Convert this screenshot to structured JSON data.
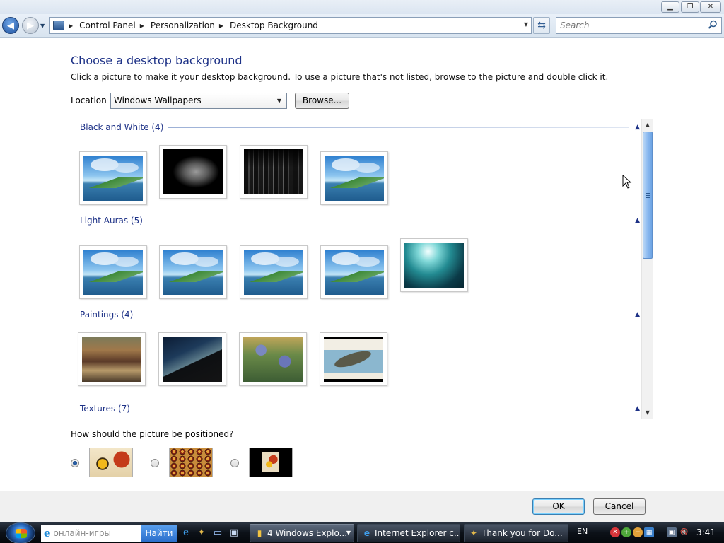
{
  "window": {
    "minimize_icon": "minimize-icon",
    "maximize_icon": "maximize-icon",
    "close_icon": "close-icon"
  },
  "address_bar": {
    "breadcrumbs": [
      "Control Panel",
      "Personalization",
      "Desktop Background"
    ],
    "search_placeholder": "Search"
  },
  "page": {
    "title": "Choose a desktop background",
    "subtitle": "Click a picture to make it your desktop background. To use a picture that's not listed, browse to the picture and double click it.",
    "location_label": "Location",
    "location_value": "Windows Wallpapers",
    "browse_label": "Browse..."
  },
  "gallery": {
    "groups": [
      {
        "title": "Black and White (4)",
        "thumbs": [
          "lake",
          "leaf",
          "city",
          "lake"
        ]
      },
      {
        "title": "Light Auras (5)",
        "thumbs": [
          "lake",
          "lake",
          "lake",
          "lake",
          "aurora"
        ]
      },
      {
        "title": "Paintings (4)",
        "thumbs": [
          "seurat",
          "bridge",
          "iris",
          "koi"
        ]
      },
      {
        "title": "Textures (7)",
        "thumbs": []
      }
    ]
  },
  "position": {
    "question": "How should the picture be positioned?",
    "options": [
      {
        "style": "fill",
        "selected": true
      },
      {
        "style": "tile",
        "selected": false
      },
      {
        "style": "center",
        "selected": false
      }
    ]
  },
  "buttons": {
    "ok": "OK",
    "cancel": "Cancel"
  },
  "taskbar": {
    "search_text": "онлайн-игры",
    "search_button": "Найти",
    "tasks": [
      {
        "label": "4 Windows Explo...",
        "active": true
      },
      {
        "label": "Internet Explorer c...",
        "active": false
      },
      {
        "label": "Thank you for Do...",
        "active": false
      }
    ],
    "language": "EN",
    "clock": "3:41"
  },
  "colors": {
    "title_blue": "#1e3287",
    "taskbar": "#0c1118",
    "scroll_thumb": "#8cbaf0"
  }
}
